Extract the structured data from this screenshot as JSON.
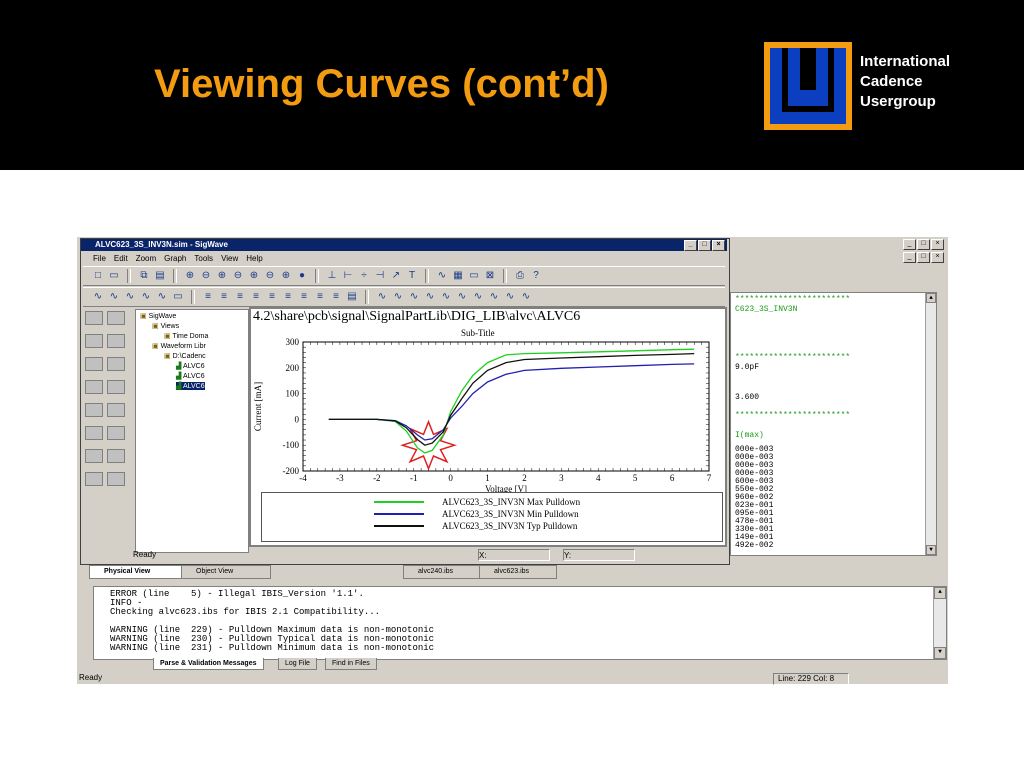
{
  "slide": {
    "title": "Viewing Curves (cont’d)",
    "logo_lines": [
      "International",
      "Cadence",
      "Usergroup"
    ]
  },
  "app": {
    "window_buttons": [
      "_",
      "□",
      "×"
    ],
    "editor_lines": [
      {
        "text": "C623_3S_INV3N",
        "color": "green"
      },
      {
        "text": "9.0pF",
        "color": "black"
      },
      {
        "text": "3.600",
        "color": "black"
      },
      {
        "text": "I(max)",
        "color": "green"
      },
      {
        "text": "000e-003",
        "color": "black"
      },
      {
        "text": "000e-003",
        "color": "black"
      },
      {
        "text": "000e-003",
        "color": "black"
      },
      {
        "text": "000e-003",
        "color": "black"
      },
      {
        "text": "600e-003",
        "color": "black"
      },
      {
        "text": "550e-002",
        "color": "black"
      },
      {
        "text": "960e-002",
        "color": "black"
      },
      {
        "text": "023e-001",
        "color": "black"
      },
      {
        "text": "095e-001",
        "color": "black"
      },
      {
        "text": "478e-001",
        "color": "black"
      },
      {
        "text": "330e-001",
        "color": "black"
      },
      {
        "text": "149e-001",
        "color": "black"
      },
      {
        "text": "492e-002",
        "color": "black"
      }
    ],
    "file_tabs": [
      "alvc240.ibs",
      "alvc623.ibs"
    ],
    "view_tabs": [
      "Physical View",
      "Object View"
    ],
    "output_lines": [
      "ERROR (line    5) - Illegal IBIS_Version '1.1'.",
      "INFO -",
      "Checking alvc623.ibs for IBIS 2.1 Compatibility...",
      "",
      "WARNING (line  229) - Pulldown Maximum data is non-monotonic",
      "WARNING (line  230) - Pulldown Typical data is non-monotonic",
      "WARNING (line  231) - Pulldown Minimum data is non-monotonic"
    ],
    "bottom_tabs": [
      "Parse & Validation Messages",
      "Log File",
      "Find in Files"
    ],
    "status": {
      "ready": "Ready",
      "position": "Line: 229 Col: 8"
    }
  },
  "sigwave": {
    "title": "ALVC623_3S_INV3N.sim - SigWave",
    "menu": [
      "File",
      "Edit",
      "Zoom",
      "Graph",
      "Tools",
      "View",
      "Help"
    ],
    "tree": [
      {
        "label": "SigWave",
        "indent": 0
      },
      {
        "label": "Views",
        "indent": 1
      },
      {
        "label": "Time Doma",
        "indent": 2
      },
      {
        "label": "Waveform Libr",
        "indent": 1
      },
      {
        "label": "D:\\Cadenc",
        "indent": 2
      },
      {
        "label": "ALVC6",
        "indent": 3
      },
      {
        "label": "ALVC6",
        "indent": 3
      },
      {
        "label": "ALVC6",
        "indent": 3,
        "selected": true
      }
    ],
    "status_ready": "Ready",
    "status_x": "X:",
    "status_y": "Y:"
  },
  "chart_data": {
    "type": "line",
    "title": "4.2\\share\\pcb\\signal\\SignalPartLib\\DIG_LIB\\alvc\\ALVC6",
    "subtitle": "Sub-Title",
    "xlabel": "Voltage [V]",
    "ylabel": "Current [mA]",
    "xlim": [
      -4,
      7
    ],
    "ylim": [
      -200,
      300
    ],
    "xticks": [
      -4,
      -3,
      -2,
      -1,
      0,
      1,
      2,
      3,
      4,
      5,
      6,
      7
    ],
    "yticks": [
      -200,
      -100,
      0,
      100,
      200,
      300
    ],
    "series": [
      {
        "name": "ALVC623_3S_INV3N Max  Pulldown",
        "color": "#20d020",
        "x": [
          -3.3,
          -2.0,
          -1.5,
          -1.2,
          -0.9,
          -0.7,
          -0.5,
          -0.2,
          0.0,
          0.3,
          0.6,
          1.0,
          1.5,
          2.0,
          3.0,
          4.0,
          5.0,
          6.0,
          6.6
        ],
        "y": [
          0,
          0,
          -8,
          -45,
          -110,
          -130,
          -120,
          -60,
          30,
          110,
          170,
          220,
          250,
          255,
          258,
          262,
          266,
          270,
          272
        ]
      },
      {
        "name": "ALVC623_3S_INV3N Min  Pulldown",
        "color": "#2020b0",
        "x": [
          -3.3,
          -2.0,
          -1.5,
          -1.2,
          -0.9,
          -0.7,
          -0.5,
          -0.2,
          0.0,
          0.3,
          0.6,
          1.0,
          1.5,
          2.0,
          3.0,
          4.0,
          5.0,
          6.0,
          6.6
        ],
        "y": [
          0,
          0,
          -5,
          -25,
          -60,
          -80,
          -75,
          -40,
          5,
          50,
          100,
          145,
          175,
          190,
          198,
          203,
          208,
          213,
          215
        ]
      },
      {
        "name": "ALVC623_3S_INV3N Typ  Pulldown",
        "color": "#101010",
        "x": [
          -3.3,
          -2.0,
          -1.5,
          -1.2,
          -0.9,
          -0.7,
          -0.5,
          -0.2,
          0.0,
          0.3,
          0.6,
          1.0,
          1.5,
          2.0,
          3.0,
          4.0,
          5.0,
          6.0,
          6.6
        ],
        "y": [
          0,
          0,
          -6,
          -32,
          -78,
          -100,
          -92,
          -48,
          15,
          80,
          140,
          190,
          220,
          232,
          238,
          243,
          248,
          252,
          255
        ]
      }
    ],
    "grid": false,
    "legend": "bottom"
  }
}
